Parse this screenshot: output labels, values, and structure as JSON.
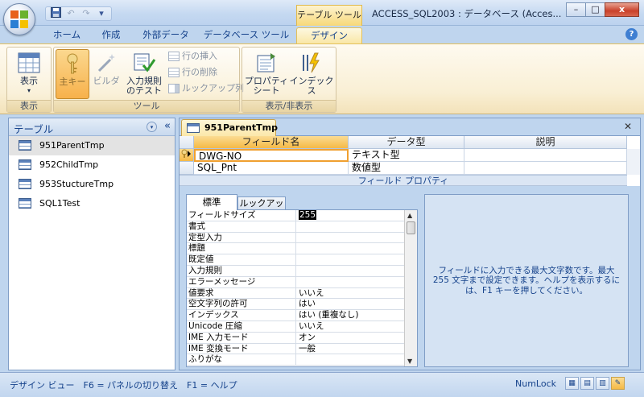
{
  "window": {
    "context_tab": "テーブル ツール",
    "title": "ACCESS_SQL2003 : データベース (Acces...",
    "controls": {
      "minimize": "–",
      "maximize": "□",
      "close": "x"
    }
  },
  "qat": {
    "save_icon": "save-icon",
    "undo": "↶",
    "redo": "↷",
    "customize": "▾"
  },
  "ribbon": {
    "tabs": [
      "ホーム",
      "作成",
      "外部データ",
      "データベース ツール",
      "デザイン"
    ],
    "active_tab": "デザイン",
    "groups": {
      "views": {
        "label": "表示",
        "view_button": "表示",
        "view_arrow": "▾"
      },
      "tools": {
        "label": "ツール",
        "primary_key": "主キー",
        "builder": "ビルダ",
        "test_rules_1": "入力規則",
        "test_rules_2": "のテスト",
        "insert_rows": "行の挿入",
        "delete_rows": "行の削除",
        "lookup_column": "ルックアップ列"
      },
      "show_hide": {
        "label": "表示/非表示",
        "property_sheet_1": "プロパティ",
        "property_sheet_2": "シート",
        "indexes": "インデックス"
      }
    }
  },
  "nav": {
    "title": "テーブル",
    "dropdown": "▾",
    "collapse": "«",
    "items": [
      {
        "label": "951ParentTmp",
        "selected": true
      },
      {
        "label": "952ChildTmp"
      },
      {
        "label": "953StuctureTmp"
      },
      {
        "label": "SQL1Test"
      }
    ]
  },
  "document": {
    "tab_label": "951ParentTmp",
    "close": "✕",
    "columns": {
      "field_name": "フィールド名",
      "data_type": "データ型",
      "description": "説明"
    },
    "rows": [
      {
        "field_name": "DWG-NO",
        "data_type": "テキスト型",
        "description": "",
        "primary_key": true
      },
      {
        "field_name": "SQL_Pnt",
        "data_type": "数値型",
        "description": ""
      }
    ],
    "field_properties_label": "フィールド プロパティ",
    "property_tabs": [
      "標準",
      "ルックアップ"
    ],
    "properties": [
      {
        "name": "フィールドサイズ",
        "value": "255"
      },
      {
        "name": "書式",
        "value": ""
      },
      {
        "name": "定型入力",
        "value": ""
      },
      {
        "name": "標題",
        "value": ""
      },
      {
        "name": "既定値",
        "value": ""
      },
      {
        "name": "入力規則",
        "value": ""
      },
      {
        "name": "エラーメッセージ",
        "value": ""
      },
      {
        "name": "値要求",
        "value": "いいえ"
      },
      {
        "name": "空文字列の許可",
        "value": "はい"
      },
      {
        "name": "インデックス",
        "value": "はい (重複なし)"
      },
      {
        "name": "Unicode 圧縮",
        "value": "いいえ"
      },
      {
        "name": "IME 入力モード",
        "value": "オン"
      },
      {
        "name": "IME 変換モード",
        "value": "一般"
      },
      {
        "name": "ふりがな",
        "value": ""
      }
    ],
    "description_text": "フィールドに入力できる最大文字数です。最大 255 文字まで設定できます。ヘルプを表示するには、F1 キーを押してください。"
  },
  "status": {
    "text": "デザイン ビュー　F6 = パネルの切り替え　F1 = ヘルプ",
    "numlock": "NumLock"
  },
  "colors": {
    "accent": "#15428b",
    "selected_tab": "#f9e7a6",
    "ribbon_bg": "#bfd5ee"
  }
}
